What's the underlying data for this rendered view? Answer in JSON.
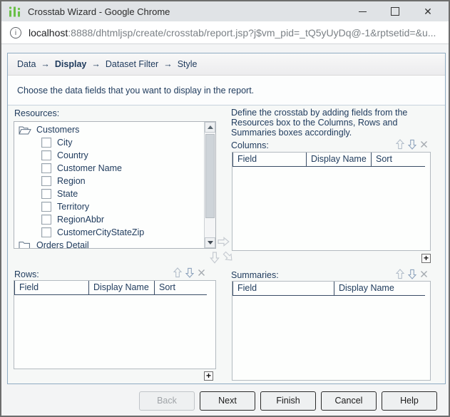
{
  "window": {
    "title": "Crosstab Wizard - Google Chrome",
    "controls": {
      "minimize": "minimize",
      "maximize": "maximize",
      "close": "close"
    }
  },
  "icons": {
    "info": "i",
    "close_glyph": "✕",
    "plus": "+"
  },
  "address": {
    "host": "localhost",
    "rest": ":8888/dhtmljsp/create/crosstab/report.jsp?j$vm_pid=_tQ5yUyDq@-1&rptsetid=&u..."
  },
  "breadcrumb": {
    "separator": "→",
    "steps": [
      {
        "label": "Data",
        "current": false
      },
      {
        "label": "Display",
        "current": true
      },
      {
        "label": "Dataset Filter",
        "current": false
      },
      {
        "label": "Style",
        "current": false
      }
    ]
  },
  "instruction": "Choose the data fields that you want to display in the report.",
  "resources": {
    "label": "Resources:",
    "items": [
      {
        "type": "folder-open",
        "label": "Customers"
      },
      {
        "type": "field",
        "label": "City"
      },
      {
        "type": "field",
        "label": "Country"
      },
      {
        "type": "field",
        "label": "Customer Name"
      },
      {
        "type": "field",
        "label": "Region"
      },
      {
        "type": "field",
        "label": "State"
      },
      {
        "type": "field",
        "label": "Territory"
      },
      {
        "type": "field",
        "label": "RegionAbbr"
      },
      {
        "type": "field",
        "label": "CustomerCityStateZip"
      },
      {
        "type": "folder-closed",
        "label": "Orders Detail"
      }
    ]
  },
  "define_text": "Define the crosstab by adding fields from the Resources box to the Columns, Rows and Summaries boxes accordingly.",
  "columns": {
    "label": "Columns:",
    "headers": [
      "Field",
      "Display Name",
      "Sort"
    ]
  },
  "rows": {
    "label": "Rows:",
    "headers": [
      "Field",
      "Display Name",
      "Sort"
    ]
  },
  "summaries": {
    "label": "Summaries:",
    "headers": [
      "Field",
      "Display Name"
    ]
  },
  "buttons": {
    "back": "Back",
    "next": "Next",
    "finish": "Finish",
    "cancel": "Cancel",
    "help": "Help"
  },
  "colors": {
    "accent_text": "#1e3a5c",
    "panel_border": "#8fabc2",
    "logo_green": "#6abf47"
  }
}
